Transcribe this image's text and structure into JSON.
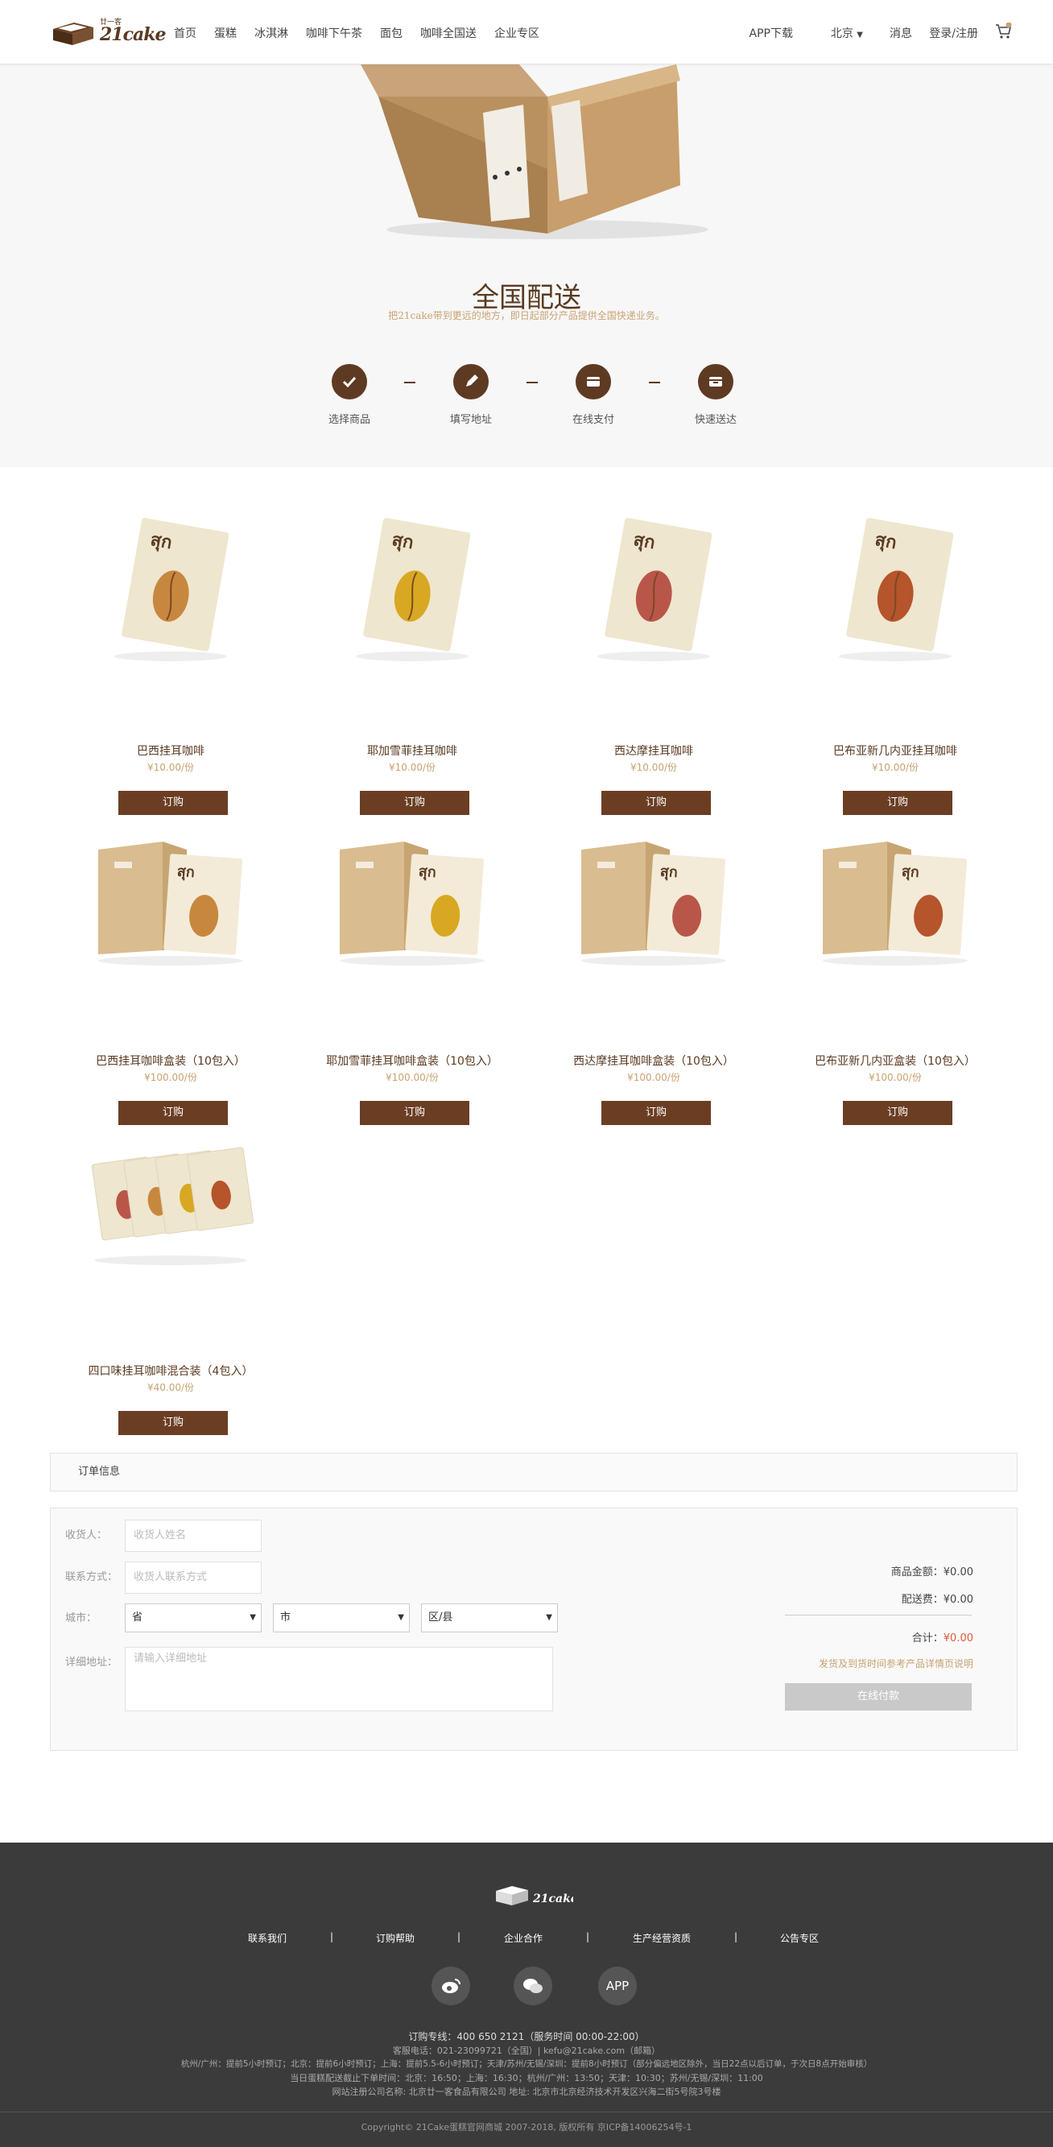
{
  "brand": {
    "logo_cn": "廿一客",
    "logo_en": "21cake"
  },
  "nav": {
    "items": [
      "首页",
      "蛋糕",
      "冰淇淋",
      "咖啡下午茶",
      "面包",
      "咖啡全国送",
      "企业专区"
    ],
    "app_download": "APP下载",
    "city": "北京",
    "messages": "消息",
    "login": "登录/注册",
    "cart_count": "0"
  },
  "hero": {
    "title": "全国配送",
    "subtitle": "把21cake带到更远的地方，即日起部分产品提供全国快递业务。",
    "steps": [
      {
        "label": "选择商品",
        "icon": "check-icon"
      },
      {
        "label": "填写地址",
        "icon": "pencil-icon"
      },
      {
        "label": "在线支付",
        "icon": "wallet-icon"
      },
      {
        "label": "快速送达",
        "icon": "package-icon"
      }
    ]
  },
  "products": [
    {
      "name": "巴西挂耳咖啡",
      "price": "¥10.00/份",
      "button": "订购",
      "kind": "single",
      "bean_color": "#c8873f"
    },
    {
      "name": "耶加雪菲挂耳咖啡",
      "price": "¥10.00/份",
      "button": "订购",
      "kind": "single",
      "bean_color": "#d8a822"
    },
    {
      "name": "西达摩挂耳咖啡",
      "price": "¥10.00/份",
      "button": "订购",
      "kind": "single",
      "bean_color": "#b9564a"
    },
    {
      "name": "巴布亚新几内亚挂耳咖啡",
      "price": "¥10.00/份",
      "button": "订购",
      "kind": "single",
      "bean_color": "#b6542c"
    },
    {
      "name": "巴西挂耳咖啡盒装（10包入）",
      "price": "¥100.00/份",
      "button": "订购",
      "kind": "box",
      "bean_color": "#c8873f"
    },
    {
      "name": "耶加雪菲挂耳咖啡盒装（10包入）",
      "price": "¥100.00/份",
      "button": "订购",
      "kind": "box",
      "bean_color": "#d8a822"
    },
    {
      "name": "西达摩挂耳咖啡盒装（10包入）",
      "price": "¥100.00/份",
      "button": "订购",
      "kind": "box",
      "bean_color": "#b9564a"
    },
    {
      "name": "巴布亚新几内亚盒装（10包入）",
      "price": "¥100.00/份",
      "button": "订购",
      "kind": "box",
      "bean_color": "#b6542c"
    },
    {
      "name": "四口味挂耳咖啡混合装（4包入）",
      "price": "¥40.00/份",
      "button": "订购",
      "kind": "mix",
      "bean_color": "#c8873f"
    }
  ],
  "order": {
    "header": "订单信息",
    "receiver_label": "收货人：",
    "receiver_placeholder": "收货人姓名",
    "contact_label": "联系方式：",
    "contact_placeholder": "收货人联系方式",
    "city_label": "城市：",
    "province": "省",
    "city": "市",
    "district": "区/县",
    "address_label": "详细地址：",
    "address_placeholder": "请输入详细地址",
    "goods_amount_label": "商品金额：",
    "goods_amount": "¥0.00",
    "shipping_label": "配送费：",
    "shipping": "¥0.00",
    "total_label": "合计：",
    "total": "¥0.00",
    "note": "发货及到货时间参考产品详情页说明",
    "pay_button": "在线付款"
  },
  "footer": {
    "links": [
      "联系我们",
      "订购帮助",
      "企业合作",
      "生产经营资质",
      "公告专区"
    ],
    "separator": "|",
    "social": [
      {
        "icon": "weibo-icon"
      },
      {
        "icon": "wechat-icon"
      },
      {
        "label": "APP"
      }
    ],
    "hotline": "订购专线：400 650 2121（服务时间 00:00-22:00）",
    "service": "客服电话：021-23099721（全国）| kefu@21cake.com（邮箱）",
    "info1": "杭州/广州：提前5小时预订；北京：提前6小时预订；上海：提前5.5-6小时预订；天津/苏州/无锡/深圳：提前8小时预订（部分偏远地区除外，当日22点以后订单，于次日8点开始审核）",
    "info2": "当日蛋糕配送截止下单时间：北京：16:50；上海：16:30；杭州/广州：13:50；天津：10:30；苏州/无锡/深圳：11:00",
    "info3": "网站注册公司名称: 北京廿一客食品有限公司 地址: 北京市北京经济技术开发区兴海二街5号院3号楼",
    "copyright": "Copyright© 21Cake蛋糕官网商城 2007-2018, 版权所有 京ICP备14006254号-1"
  }
}
